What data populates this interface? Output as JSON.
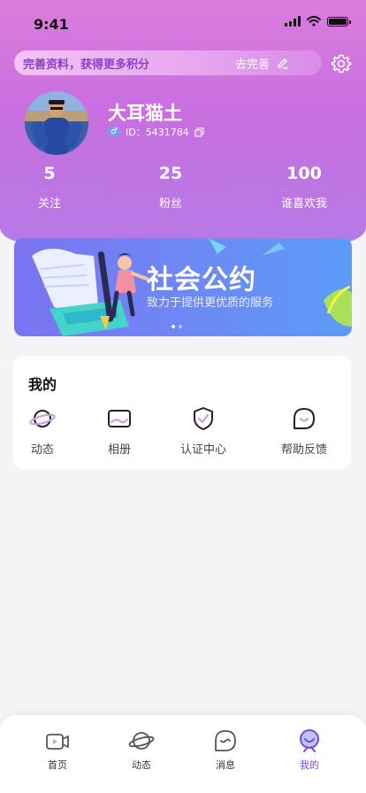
{
  "status_bar": {
    "time": "9:41"
  },
  "profile_banner": {
    "text": "完善资料，获得更多积分",
    "action": "去完善"
  },
  "user": {
    "name": "大耳猫土",
    "gender_symbol": "♂",
    "id_text": "ID：5431784"
  },
  "stats": [
    {
      "value": "5",
      "label": "关注"
    },
    {
      "value": "25",
      "label": "粉丝"
    },
    {
      "value": "100",
      "label": "谁喜欢我"
    }
  ],
  "promo": {
    "title": "社会公约",
    "subtitle": "致力于提供更优质的服务",
    "page_count": 2,
    "active_page": 1
  },
  "my_section": {
    "title": "我的",
    "items": [
      {
        "label": "动态",
        "icon": "planet-icon"
      },
      {
        "label": "相册",
        "icon": "album-icon"
      },
      {
        "label": "认证中心",
        "icon": "shield-check-icon"
      },
      {
        "label": "帮助反馈",
        "icon": "chat-bubble-icon"
      }
    ]
  },
  "tabbar": {
    "items": [
      {
        "label": "首页",
        "icon": "video-icon"
      },
      {
        "label": "动态",
        "icon": "planet-icon"
      },
      {
        "label": "消息",
        "icon": "message-icon"
      },
      {
        "label": "我的",
        "icon": "profile-icon"
      }
    ],
    "active_index": 3
  },
  "colors": {
    "accent": "#7a46e0",
    "header_top": "#db7ddc",
    "header_bottom": "#b57ae6"
  }
}
